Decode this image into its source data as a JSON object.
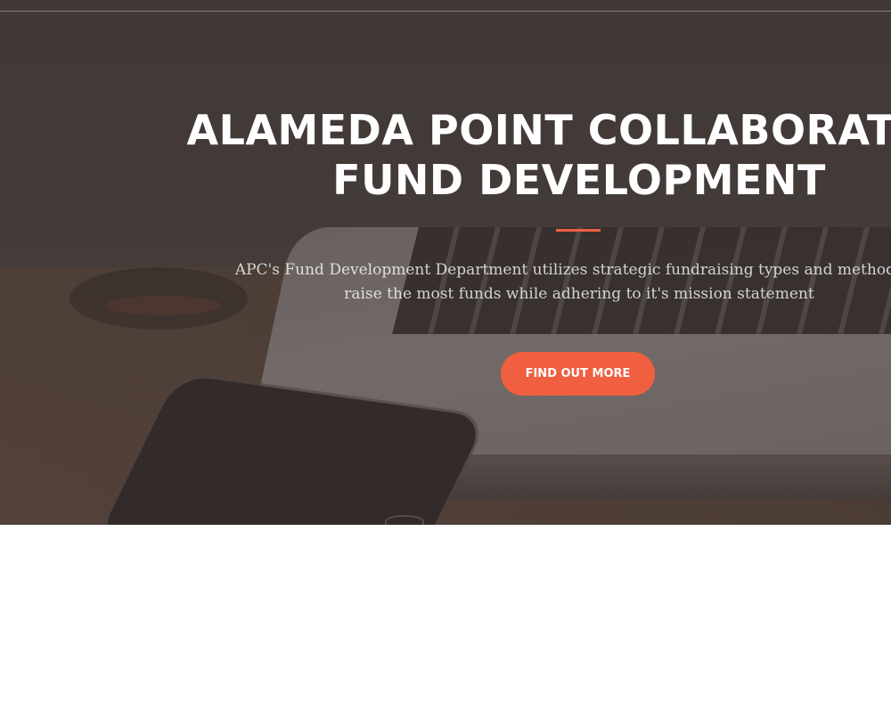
{
  "hero": {
    "title_line1": "ALAMEDA POINT COLLABORATIVE",
    "title_line2": "FUND DEVELOPMENT",
    "subtitle_line1": "APC's Fund Development Department utilizes strategic fundraising types and methods to",
    "subtitle_line2": "raise the most funds while adhering to it's mission statement",
    "cta_label": "FIND OUT MORE"
  },
  "colors": {
    "accent": "#f05f40",
    "overlay": "#3c3230",
    "text": "#ffffff",
    "page_background": "#ffffff"
  }
}
